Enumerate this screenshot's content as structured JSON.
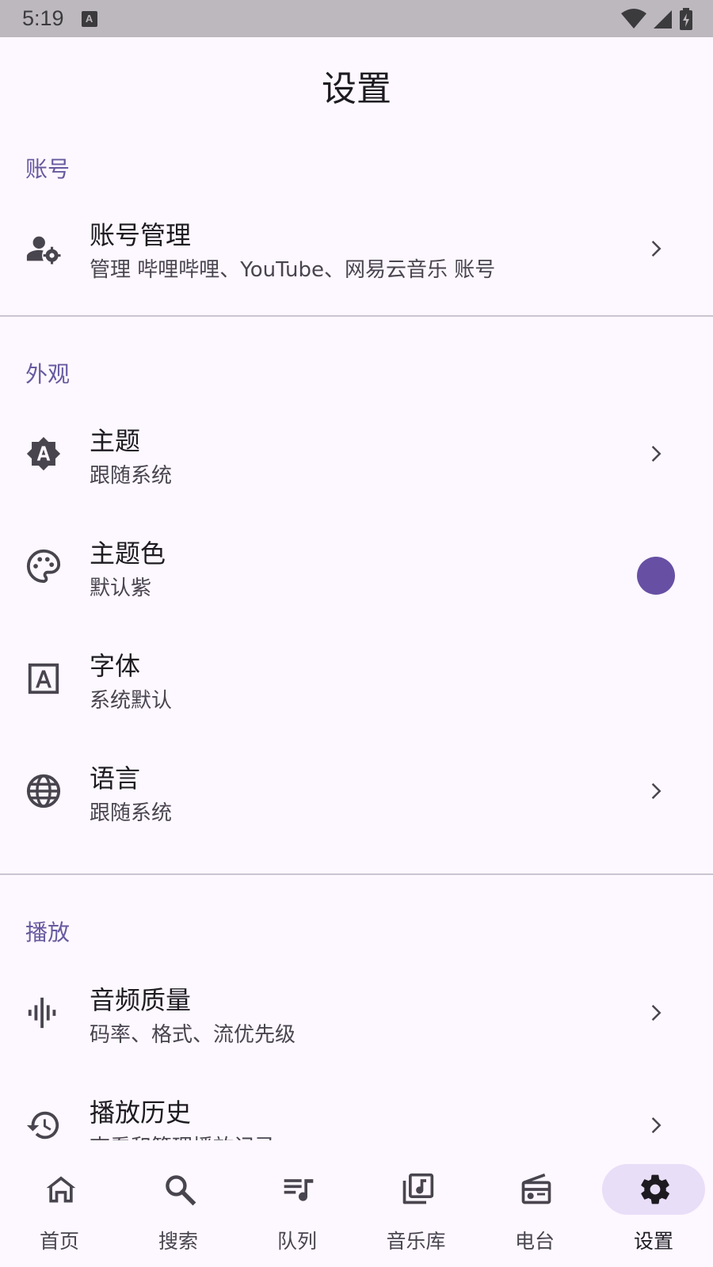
{
  "status_bar": {
    "time": "5:19",
    "app_badge": "A"
  },
  "header": {
    "title": "设置"
  },
  "sections": {
    "account": {
      "label": "账号"
    },
    "appearance": {
      "label": "外观"
    },
    "playback": {
      "label": "播放"
    }
  },
  "items": {
    "account_mgmt": {
      "title": "账号管理",
      "subtitle": "管理 哔哩哔哩、YouTube、网易云音乐 账号",
      "icon": "manage-accounts-icon"
    },
    "theme": {
      "title": "主题",
      "subtitle": "跟随系统",
      "icon": "brightness-auto-icon"
    },
    "theme_color": {
      "title": "主题色",
      "subtitle": "默认紫",
      "icon": "palette-icon",
      "color": "#6750a4"
    },
    "font": {
      "title": "字体",
      "subtitle": "系统默认",
      "icon": "font-icon"
    },
    "language": {
      "title": "语言",
      "subtitle": "跟随系统",
      "icon": "globe-icon"
    },
    "audio_quality": {
      "title": "音频质量",
      "subtitle": "码率、格式、流优先级",
      "icon": "graphic-eq-icon"
    },
    "play_history": {
      "title": "播放历史",
      "subtitle": "查看和管理播放记录",
      "icon": "history-icon"
    }
  },
  "bottom_nav": [
    {
      "label": "首页",
      "icon": "home-icon"
    },
    {
      "label": "搜索",
      "icon": "search-icon"
    },
    {
      "label": "队列",
      "icon": "queue-music-icon"
    },
    {
      "label": "音乐库",
      "icon": "library-music-icon"
    },
    {
      "label": "电台",
      "icon": "radio-icon"
    },
    {
      "label": "设置",
      "icon": "settings-icon",
      "active": true
    }
  ],
  "colors": {
    "background": "#fdf7ff",
    "accent": "#675a9f",
    "active_pill": "#e8def8",
    "theme_dot": "#6750a4"
  }
}
